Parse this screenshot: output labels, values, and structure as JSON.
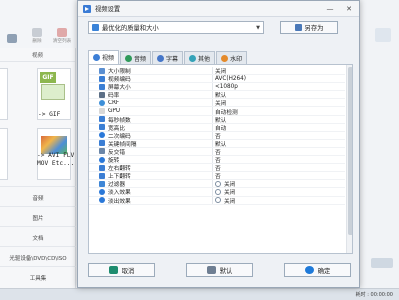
{
  "background": {
    "toolbar": [
      {
        "label": "",
        "icon": "back-icon"
      },
      {
        "label": "删除",
        "icon": "delete-icon"
      },
      {
        "label": "清空列表",
        "icon": "clear-list-icon"
      }
    ],
    "section_title": "视频",
    "tiles": [
      {
        "label": "-> GIF",
        "badge": "GIF"
      },
      {
        "label": "-> AVI FLV\nMOV Etc..."
      }
    ],
    "categories": [
      "音频",
      "图片",
      "文档",
      "光驱设备\\DVD\\CD\\ISO",
      "工具集"
    ],
    "status": "耗时 : 00:00:00"
  },
  "dialog": {
    "title": "视频设置",
    "preset": {
      "label": "最优化的质量和大小"
    },
    "save_as": "另存为",
    "tabs": [
      {
        "label": "视频",
        "color": "#3d7fd6"
      },
      {
        "label": "音频",
        "color": "#2f9a5b"
      },
      {
        "label": "字幕",
        "color": "#4677c9"
      },
      {
        "label": "其他",
        "color": "#35a2b8"
      },
      {
        "label": "水印",
        "color": "#e48a2b"
      }
    ],
    "properties": [
      {
        "name": "大小限制",
        "value": "关闭",
        "icon_color": "#5b8fd1"
      },
      {
        "name": "视频编码",
        "value": "AVC(H264)",
        "icon_color": "#3b7ed4"
      },
      {
        "name": "屏幕大小",
        "value": "<1080p",
        "icon_color": "#3b7ed4"
      },
      {
        "name": "码率",
        "value": "默认",
        "icon_color": "#5c6f86"
      },
      {
        "name": "CRF",
        "value": "关闭",
        "icon_color": "#3d8fd8"
      },
      {
        "name": "GPU",
        "value": "自动检测",
        "icon_color": "#d8d8d8"
      },
      {
        "name": "每秒帧数",
        "value": "默认",
        "icon_color": "#3b7ed4"
      },
      {
        "name": "宽高比",
        "value": "自动",
        "icon_color": "#3b7ed4"
      },
      {
        "name": "二次编码",
        "value": "否",
        "icon_color": "#2a78d8"
      },
      {
        "name": "关键帧间隔",
        "value": "默认",
        "icon_color": "#3b7ed4"
      },
      {
        "name": "反交错",
        "value": "否",
        "icon_color": "#6b86a8"
      },
      {
        "name": "旋转",
        "value": "否",
        "icon_color": "#2a78d8"
      },
      {
        "name": "左右翻转",
        "value": "否",
        "icon_color": "#3b7ed4"
      },
      {
        "name": "上下翻转",
        "value": "否",
        "icon_color": "#3b7ed4"
      },
      {
        "name": "过滤器",
        "value": "关闭",
        "icon_color": "#3e86d6"
      },
      {
        "name": "淡入效果",
        "value": "关闭",
        "icon_color": "#2a78d8"
      },
      {
        "name": "淡出效果",
        "value": "关闭",
        "icon_color": "#2a78d8"
      }
    ],
    "buttons": {
      "cancel": "取消",
      "default": "默认",
      "ok": "确定"
    }
  }
}
